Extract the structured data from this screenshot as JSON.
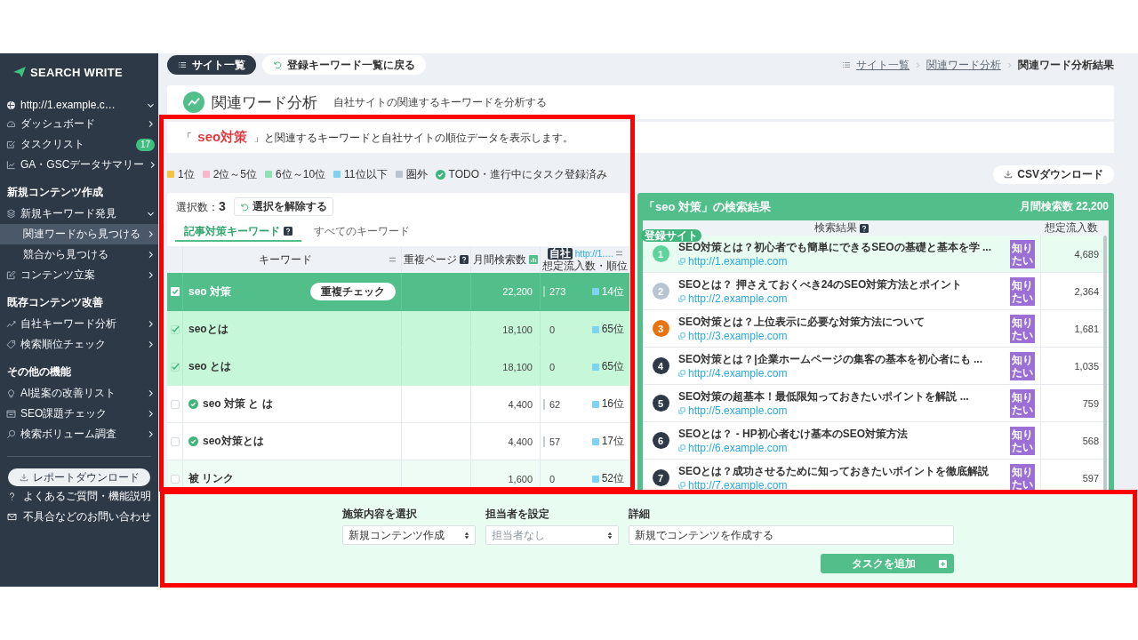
{
  "sidebar": {
    "logo": "SEARCH WRITE",
    "site_selector": "http://1.example.c…",
    "menu": [
      {
        "items": [
          {
            "label": "ダッシュボード",
            "selected": false,
            "expanded": false
          },
          {
            "label": "タスクリスト",
            "selected": false,
            "badge": "17"
          },
          {
            "label": "GA・GSCデータサマリー",
            "selected": false,
            "expanded": false
          }
        ]
      },
      {
        "title": "新規コンテンツ作成",
        "items": [
          {
            "label": "新規キーワード発見",
            "selected": false,
            "expanded": true,
            "children": [
              {
                "label": "関連ワードから見つける",
                "selected": true
              },
              {
                "label": "競合から見つける",
                "selected": false
              }
            ]
          },
          {
            "label": "コンテンツ立案",
            "selected": false,
            "expanded": false
          }
        ]
      },
      {
        "title": "既存コンテンツ改善",
        "items": [
          {
            "label": "自社キーワード分析",
            "selected": false,
            "expanded": false
          },
          {
            "label": "検索順位チェック",
            "selected": false,
            "expanded": false
          }
        ]
      },
      {
        "title": "その他の機能",
        "items": [
          {
            "label": "AI提案の改善リスト",
            "selected": false,
            "expanded": false
          },
          {
            "label": "SEO課題チェック",
            "selected": false,
            "expanded": false
          },
          {
            "label": "検索ボリューム調査",
            "selected": false,
            "expanded": false
          }
        ]
      }
    ],
    "report_button": "レポートダウンロード",
    "help_links": [
      "よくあるご質問・機能説明",
      "不具合などのお問い合わせ"
    ]
  },
  "top_bar": {
    "buttons": [
      {
        "kind": "primary",
        "label": "サイト一覧"
      },
      {
        "kind": "back",
        "label": "登録キーワード一覧に戻る"
      }
    ],
    "breadcrumb": [
      {
        "label": "サイト一覧",
        "current": false
      },
      {
        "label": "関連ワード分析",
        "current": false
      },
      {
        "label": "関連ワード分析結果",
        "current": true
      }
    ]
  },
  "page_header": {
    "title": "関連ワード分析",
    "subtitle": "自社サイトの関連するキーワードを分析する"
  },
  "intro": "「 **seo対策** 」と関連するキーワードと自社サイトの順位データを表示します。",
  "legend": [
    {
      "kind": "swatch",
      "label": "1位",
      "color": "#f5c342"
    },
    {
      "kind": "swatch",
      "label": "2位～5位",
      "color": "#f7b9ca"
    },
    {
      "kind": "swatch",
      "label": "6位～10位",
      "color": "#8ee0b5"
    },
    {
      "kind": "swatch",
      "label": "11位以下",
      "color": "#7dd3f0"
    },
    {
      "kind": "swatch",
      "label": "圏外",
      "color": "#b8c4d0"
    },
    {
      "kind": "check",
      "label": "TODO・進行中にタスク登録済み"
    }
  ],
  "csv_button": "CSVダウンロード",
  "keyword_panel": {
    "selection": "選択数：**3**",
    "clear_button": "選択を解除する",
    "tabs": [
      {
        "label": "記事対策キーワード",
        "selected": true,
        "help": true
      },
      {
        "label": "すべてのキーワード",
        "selected": false,
        "help": false
      }
    ],
    "table": {
      "columns": [
        {
          "label": "キーワード"
        },
        {
          "label": "重複ページ"
        },
        {
          "label": "月間検索数"
        },
        {
          "badge": "自社",
          "link": "http://1.…",
          "label": "想定流入数・順位"
        }
      ],
      "rows": [
        {
          "kind": "main",
          "selected": true,
          "highlighted": false,
          "todo": false,
          "keyword": "seo 対策",
          "action": "重複チェック",
          "volume": "22,200",
          "traffic": {
            "value": "273",
            "bar": true
          },
          "color": "#7dd3f0",
          "rank": "14位"
        },
        {
          "kind": "keyword",
          "selected": true,
          "highlighted": false,
          "todo": false,
          "keyword": "seoとは",
          "volume": "18,100",
          "traffic": {
            "value": "0",
            "bar": false
          },
          "color": "#7dd3f0",
          "rank": "65位"
        },
        {
          "kind": "keyword",
          "selected": true,
          "highlighted": false,
          "todo": false,
          "keyword": "seo とは",
          "volume": "18,100",
          "traffic": {
            "value": "0",
            "bar": false
          },
          "color": "#7dd3f0",
          "rank": "65位"
        },
        {
          "kind": "keyword",
          "selected": false,
          "highlighted": false,
          "todo": true,
          "keyword": "seo 対策 と は",
          "volume": "4,400",
          "traffic": {
            "value": "62",
            "bar": true
          },
          "color": "#7dd3f0",
          "rank": "16位"
        },
        {
          "kind": "keyword",
          "selected": false,
          "highlighted": false,
          "todo": true,
          "keyword": "seo対策とは",
          "volume": "4,400",
          "traffic": {
            "value": "57",
            "bar": true
          },
          "color": "#7dd3f0",
          "rank": "17位"
        },
        {
          "kind": "keyword",
          "selected": false,
          "highlighted": true,
          "todo": false,
          "keyword": "被 リンク",
          "volume": "1,600",
          "traffic": {
            "value": "0",
            "bar": false
          },
          "color": "#7dd3f0",
          "rank": "52位"
        }
      ]
    }
  },
  "results": {
    "title": "「seo 対策」の検索結果",
    "volume_label": "月間検索数 22,200",
    "columns": [
      {
        "label": "検索結果"
      },
      {
        "label": "想定流入数"
      }
    ],
    "rows": [
      {
        "rank": "1",
        "color": "#5fd39c",
        "own_site": true,
        "tag": "登録サイト",
        "title": "SEO対策とは？初心者でも簡単にできるSEOの基礎と基本を学 ...",
        "url": "http://1.example.com",
        "intent": "知りたい",
        "traffic": "4,689"
      },
      {
        "rank": "2",
        "color": "#b7c5d3",
        "own_site": false,
        "title": "SEOとは？ 押さえておくべき24のSEO対策方法とポイント",
        "url": "http://2.example.com",
        "intent": "知りたい",
        "traffic": "2,364"
      },
      {
        "rank": "3",
        "color": "#e8730f",
        "own_site": false,
        "title": "SEO対策とは？上位表示に必要な対策方法について",
        "url": "http://3.example.com",
        "intent": "知りたい",
        "traffic": "1,681"
      },
      {
        "rank": "4",
        "color": "#2e3947",
        "own_site": false,
        "title": "SEO対策とは？|企業ホームページの集客の基本を初心者にも ...",
        "url": "http://4.example.com",
        "intent": "知りたい",
        "traffic": "1,035"
      },
      {
        "rank": "5",
        "color": "#2e3947",
        "own_site": false,
        "title": "SEO対策の超基本！最低限知っておきたいポイントを解説 ...",
        "url": "http://5.example.com",
        "intent": "知りたい",
        "traffic": "759"
      },
      {
        "rank": "6",
        "color": "#2e3947",
        "own_site": false,
        "title": "SEOとは？ - HP初心者むけ基本のSEO対策方法",
        "url": "http://6.example.com",
        "intent": "知りたい",
        "traffic": "568"
      },
      {
        "rank": "7",
        "color": "#2e3947",
        "own_site": false,
        "title": "SEOとは？成功させるために知っておきたいポイントを徹底解説",
        "url": "http://7.example.com",
        "intent": "知りたい",
        "traffic": "597"
      }
    ]
  },
  "task_form": {
    "fields": [
      {
        "kind": "select",
        "label": "施策内容を選択",
        "value": "新規コンテンツ作成"
      },
      {
        "kind": "select",
        "label": "担当者を設定",
        "placeholder": "担当者なし"
      },
      {
        "kind": "text",
        "label": "詳細",
        "value": "新規でコンテンツを作成する"
      }
    ],
    "submit": "タスクを追加"
  }
}
